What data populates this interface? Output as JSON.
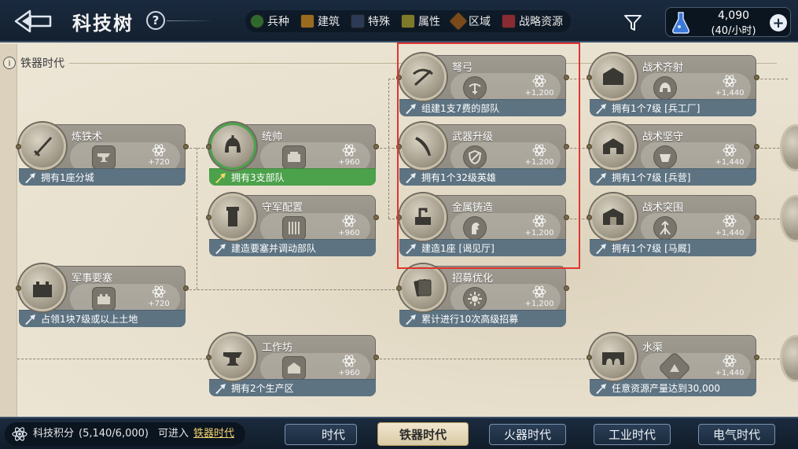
{
  "header": {
    "title": "科技树",
    "help_label": "?",
    "legend": [
      {
        "label": "兵种",
        "color": "#2f6a2c"
      },
      {
        "label": "建筑",
        "color": "#9a6a1f"
      },
      {
        "label": "特殊",
        "color": "#2d3a55"
      },
      {
        "label": "属性",
        "color": "#7f7a2a"
      },
      {
        "label": "区域",
        "color": "#7a4a1a"
      },
      {
        "label": "战略资源",
        "color": "#8a2a32"
      }
    ],
    "resource": {
      "value": "4,090",
      "rate": "(40/小时)"
    }
  },
  "era": {
    "current_label": "铁器时代",
    "info_label": "i"
  },
  "nodes": [
    {
      "name": "炼铁术",
      "cost": "+720",
      "requirement": "拥有1座分城",
      "done": false
    },
    {
      "name": "统帅",
      "cost": "+960",
      "requirement": "拥有3支部队",
      "done": true
    },
    {
      "name": "守军配置",
      "cost": "+960",
      "requirement": "建造要塞并调动部队",
      "done": false
    },
    {
      "name": "军事要塞",
      "cost": "+720",
      "requirement": "占领1块7级或以上土地",
      "done": false
    },
    {
      "name": "工作坊",
      "cost": "+960",
      "requirement": "拥有2个生产区",
      "done": false
    },
    {
      "name": "弩弓",
      "cost": "+1,200",
      "requirement": "组建1支7费的部队",
      "done": false
    },
    {
      "name": "武器升级",
      "cost": "+1,200",
      "requirement": "拥有1个32级英雄",
      "done": false
    },
    {
      "name": "金属铸造",
      "cost": "+1,200",
      "requirement": "建造1座 [谒见厅]",
      "done": false
    },
    {
      "name": "招募优化",
      "cost": "+1,200",
      "requirement": "累计进行10次高级招募",
      "done": false
    },
    {
      "name": "战术齐射",
      "cost": "+1,440",
      "requirement": "拥有1个7级 [兵工厂]",
      "done": false
    },
    {
      "name": "战术坚守",
      "cost": "+1,440",
      "requirement": "拥有1个7级 [兵营]",
      "done": false
    },
    {
      "name": "战术突围",
      "cost": "+1,440",
      "requirement": "拥有1个7级 [马厩]",
      "done": false
    },
    {
      "name": "水渠",
      "cost": "+1,440",
      "requirement": "任意资源产量达到30,000",
      "done": false
    }
  ],
  "footer": {
    "points_label": "科技积分",
    "points_value": "(5,140/6,000)",
    "enter_label": "可进入",
    "enter_link": "铁器时代",
    "tabs": [
      "时代",
      "铁器时代",
      "火器时代",
      "工业时代",
      "电气时代"
    ],
    "active_tab": 1
  }
}
